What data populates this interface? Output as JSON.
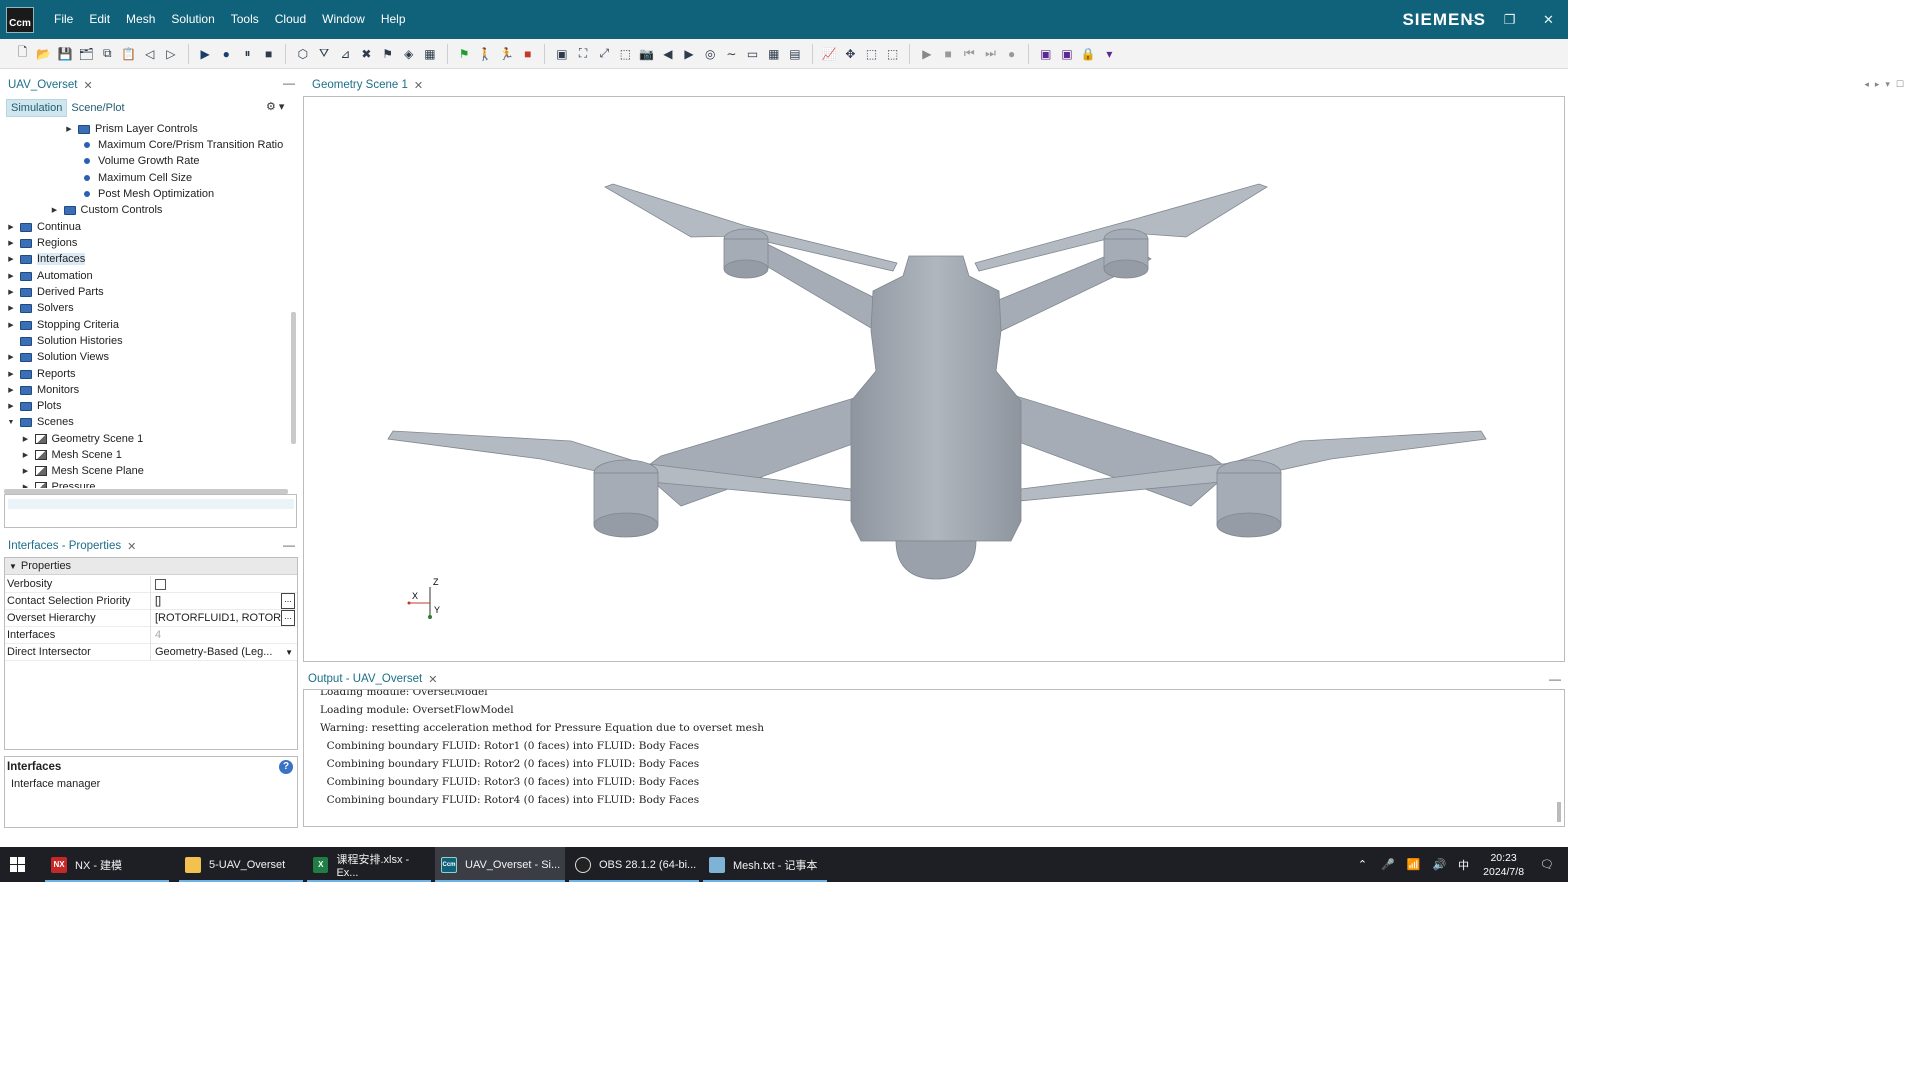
{
  "app": {
    "logo_text": "Ccm",
    "menu": [
      "File",
      "Edit",
      "Mesh",
      "Solution",
      "Tools",
      "Cloud",
      "Window",
      "Help"
    ],
    "brand": "SIEMENS",
    "window_controls": {
      "minimize": "–",
      "restore": "❐",
      "close": "✕"
    }
  },
  "toolbar": {
    "icons": [
      "new-file",
      "open",
      "save",
      "save-all",
      "copy",
      "paste",
      "undo",
      "redo",
      "sep",
      "run",
      "step",
      "pause",
      "stop",
      "sep",
      "mesh-3d",
      "filter",
      "tool-a",
      "tool-b",
      "flag-tool",
      "surface",
      "grid-tool",
      "sep",
      "green-flag",
      "walker",
      "runner",
      "red-square",
      "sep",
      "scene-view",
      "fit",
      "expand",
      "select",
      "camera",
      "arrow-left",
      "arrow-right",
      "target",
      "line",
      "ruler",
      "table",
      "table-2",
      "sep",
      "chart",
      "transform",
      "rect-select",
      "rect-select-2",
      "sep",
      "play-2",
      "stop-2",
      "prev",
      "next",
      "record",
      "sep",
      "window-1",
      "window-2",
      "lock",
      "dropdown"
    ]
  },
  "simulation_panel": {
    "tab_title": "UAV_Overset",
    "subtabs": [
      "Simulation",
      "Scene/Plot"
    ],
    "tree": [
      {
        "label": "Prism Layer Controls",
        "type": "folder",
        "level": 4,
        "expander": "collapsed"
      },
      {
        "label": "Maximum Core/Prism Transition Ratio",
        "type": "dot",
        "level": 4
      },
      {
        "label": "Volume Growth Rate",
        "type": "dot",
        "level": 4
      },
      {
        "label": "Maximum Cell Size",
        "type": "dot",
        "level": 4
      },
      {
        "label": "Post Mesh Optimization",
        "type": "dot",
        "level": 4
      },
      {
        "label": "Custom Controls",
        "type": "folder",
        "level": 3,
        "expander": "collapsed"
      },
      {
        "label": "Continua",
        "type": "folder",
        "level": 0,
        "expander": "collapsed"
      },
      {
        "label": "Regions",
        "type": "folder",
        "level": 0,
        "expander": "collapsed"
      },
      {
        "label": "Interfaces",
        "type": "folder",
        "level": 0,
        "expander": "collapsed",
        "selected": true
      },
      {
        "label": "Automation",
        "type": "folder",
        "level": 0,
        "expander": "collapsed"
      },
      {
        "label": "Derived Parts",
        "type": "folder",
        "level": 0,
        "expander": "collapsed"
      },
      {
        "label": "Solvers",
        "type": "folder",
        "level": 0,
        "expander": "collapsed"
      },
      {
        "label": "Stopping Criteria",
        "type": "folder",
        "level": 0,
        "expander": "collapsed"
      },
      {
        "label": "Solution Histories",
        "type": "folder",
        "level": 0,
        "expander": "none"
      },
      {
        "label": "Solution Views",
        "type": "folder",
        "level": 0,
        "expander": "collapsed"
      },
      {
        "label": "Reports",
        "type": "folder",
        "level": 0,
        "expander": "collapsed"
      },
      {
        "label": "Monitors",
        "type": "folder",
        "level": 0,
        "expander": "collapsed"
      },
      {
        "label": "Plots",
        "type": "folder",
        "level": 0,
        "expander": "collapsed"
      },
      {
        "label": "Scenes",
        "type": "folder",
        "level": 0,
        "expander": "expanded"
      },
      {
        "label": "Geometry Scene 1",
        "type": "scene",
        "level": 1,
        "expander": "collapsed"
      },
      {
        "label": "Mesh Scene 1",
        "type": "scene",
        "level": 1,
        "expander": "collapsed"
      },
      {
        "label": "Mesh Scene Plane",
        "type": "scene",
        "level": 1,
        "expander": "collapsed"
      },
      {
        "label": "Pressure",
        "type": "scene",
        "level": 1,
        "expander": "collapsed"
      }
    ]
  },
  "properties_panel": {
    "tab_title": "Interfaces - Properties",
    "section": "Properties",
    "rows": [
      {
        "key": "Verbosity",
        "kind": "checkbox",
        "value": "",
        "checked": false
      },
      {
        "key": "Contact Selection Priority",
        "kind": "ellipsis",
        "value": "[]"
      },
      {
        "key": "Overset Hierarchy",
        "kind": "ellipsis",
        "value": "[ROTORFLUID1, ROTOR..."
      },
      {
        "key": "Interfaces",
        "kind": "readonly",
        "value": "4"
      },
      {
        "key": "Direct Intersector",
        "kind": "dropdown",
        "value": "Geometry-Based (Leg..."
      }
    ],
    "description_title": "Interfaces",
    "description_text": "Interface manager"
  },
  "scene_panel": {
    "tab_title": "Geometry Scene 1",
    "triad": {
      "x": "X",
      "y": "Y",
      "z": "Z"
    },
    "model_color": "#a6adb6"
  },
  "output_panel": {
    "tab_title": "Output - UAV_Overset",
    "lines": [
      "Loading module: OversetModel",
      "Loading module: OversetFlowModel",
      "Warning: resetting acceleration method for Pressure Equation due to overset mesh",
      "  Combining boundary FLUID: Rotor1 (0 faces) into FLUID: Body Faces",
      "  Combining boundary FLUID: Rotor2 (0 faces) into FLUID: Body Faces",
      "  Combining boundary FLUID: Rotor3 (0 faces) into FLUID: Body Faces",
      "  Combining boundary FLUID: Rotor4 (0 faces) into FLUID: Body Faces"
    ]
  },
  "taskbar": {
    "items": [
      {
        "label": "NX - 建模",
        "icon": "NX"
      },
      {
        "label": "5-UAV_Overset",
        "icon": "folder"
      },
      {
        "label": "课程安排.xlsx - Ex...",
        "icon": "X"
      },
      {
        "label": "UAV_Overset - Si...",
        "icon": "Ccm"
      },
      {
        "label": "OBS 28.1.2 (64-bi...",
        "icon": "obs"
      },
      {
        "label": "Mesh.txt - 记事本",
        "icon": "notepad"
      }
    ],
    "ime": "中",
    "time": "20:23",
    "date": "2024/7/8"
  }
}
